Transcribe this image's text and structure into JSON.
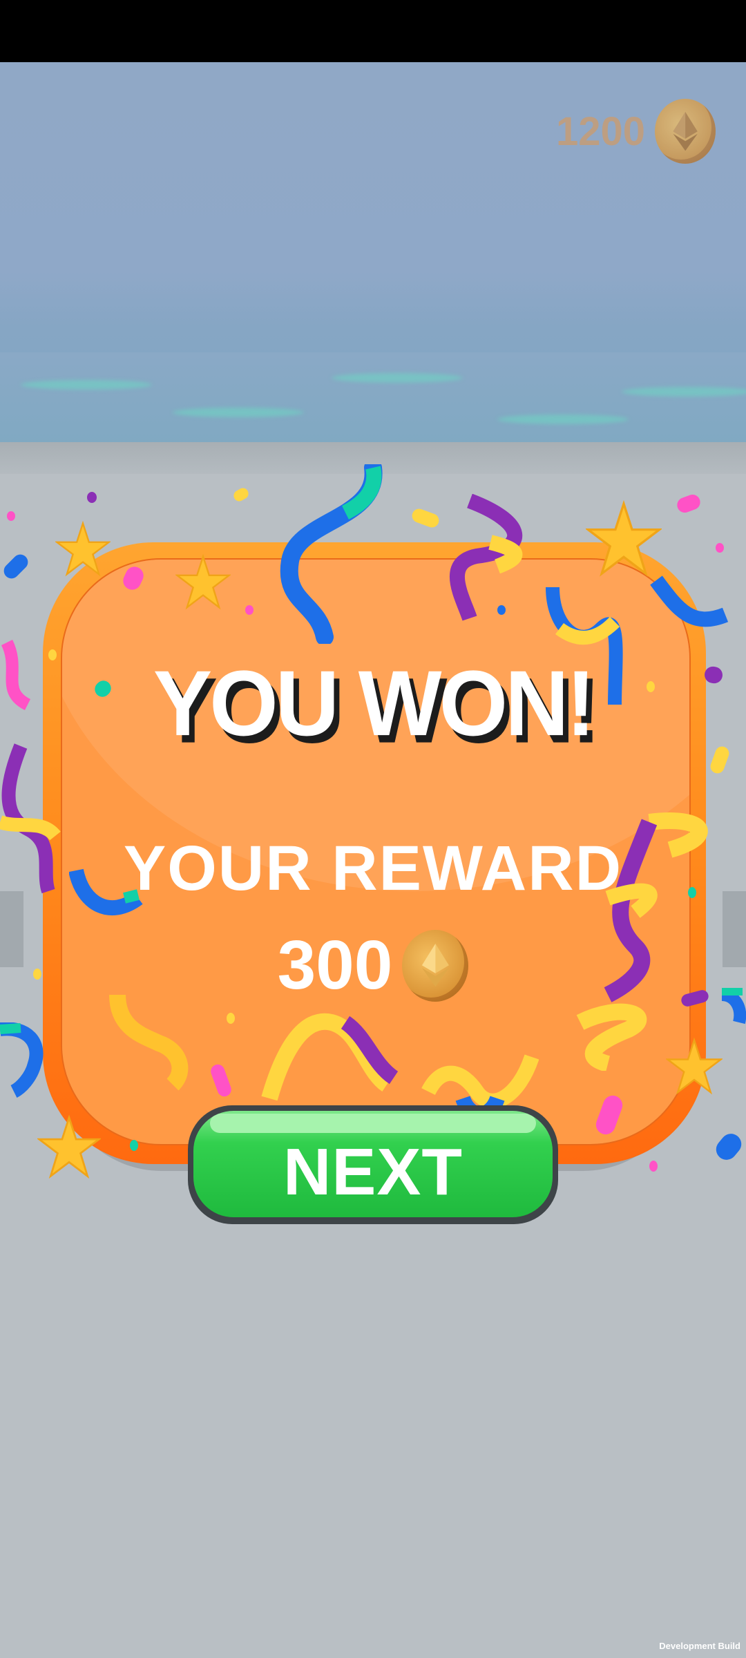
{
  "hud": {
    "coin_balance": "1200",
    "coin_icon": "ethereum-coin-icon"
  },
  "win_panel": {
    "title": "YOU WON!",
    "reward_label": "YOUR REWARD",
    "reward_amount": "300",
    "reward_icon": "ethereum-coin-icon"
  },
  "next_button": {
    "label": "NEXT"
  },
  "footer": {
    "build_label": "Development Build"
  },
  "colors": {
    "panel_orange": "#ff9a46",
    "panel_rim": "#ff7a18",
    "button_green": "#2bd14c",
    "coin_gold": "#e8a540"
  }
}
